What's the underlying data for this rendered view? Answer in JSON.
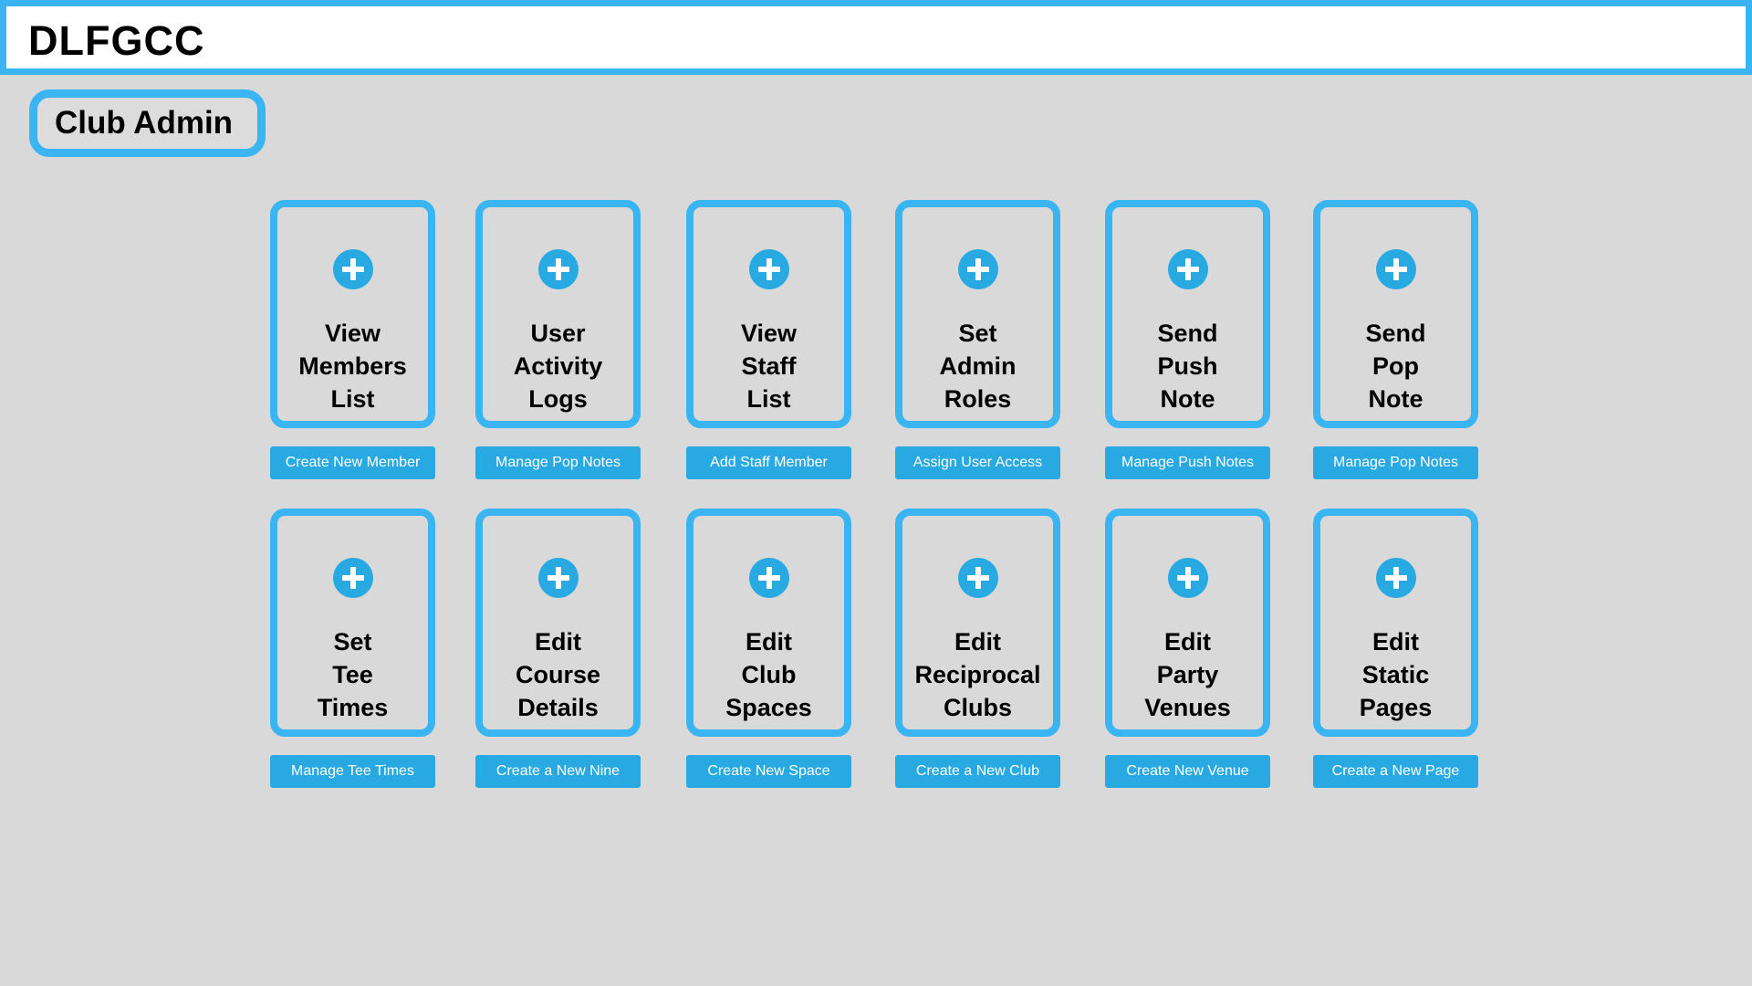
{
  "header": {
    "brand": "DLFGCC"
  },
  "section": {
    "title": "Club Admin"
  },
  "tiles": [
    {
      "label": "View\nMembers\nList",
      "action": "Create New Member"
    },
    {
      "label": "User\nActivity\nLogs",
      "action": "Manage Pop Notes"
    },
    {
      "label": "View\nStaff\nList",
      "action": "Add Staff Member"
    },
    {
      "label": "Set\nAdmin\nRoles",
      "action": "Assign User Access"
    },
    {
      "label": "Send\nPush\nNote",
      "action": "Manage Push Notes"
    },
    {
      "label": "Send\nPop\nNote",
      "action": "Manage Pop Notes"
    },
    {
      "label": "Set\nTee\nTimes",
      "action": "Manage Tee Times"
    },
    {
      "label": "Edit\nCourse\nDetails",
      "action": "Create a New Nine"
    },
    {
      "label": "Edit\nClub\nSpaces",
      "action": "Create New Space"
    },
    {
      "label": "Edit\nReciprocal\nClubs",
      "action": "Create a New Club"
    },
    {
      "label": "Edit\nParty\nVenues",
      "action": "Create New Venue"
    },
    {
      "label": "Edit\nStatic\nPages",
      "action": "Create a New Page"
    }
  ],
  "colors": {
    "accent": "#3bb4f2",
    "button": "#29a9e1",
    "background": "#d9d9d9"
  },
  "icons": {
    "tile_icon": "plus-circle-icon"
  }
}
